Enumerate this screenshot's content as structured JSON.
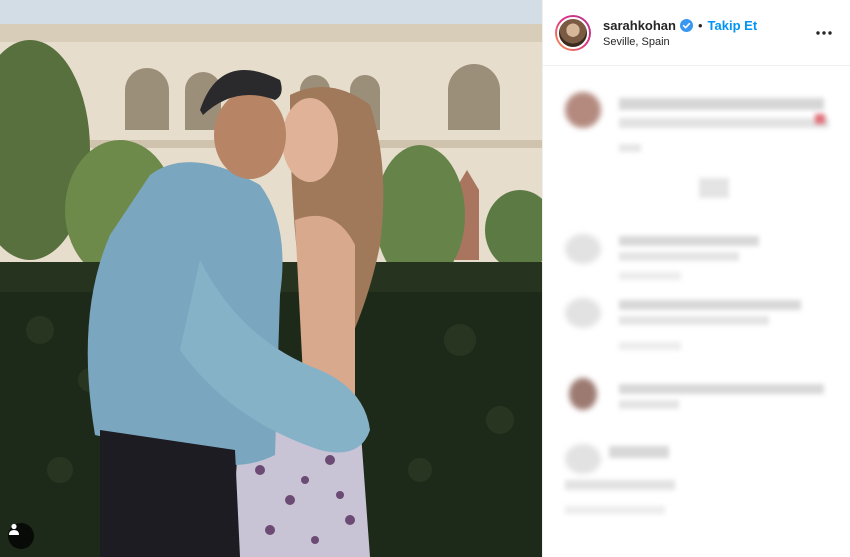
{
  "post": {
    "username": "sarahkohan",
    "verified": true,
    "separator": "•",
    "follow_label": "Takip Et",
    "location": "Seville, Spain"
  },
  "icons": {
    "verified": "verified-badge-icon",
    "more": "more-options-icon",
    "user_tag": "user-tag-icon"
  },
  "colors": {
    "accent": "#0095f6",
    "verified": "#3897f0",
    "text": "#262626"
  }
}
